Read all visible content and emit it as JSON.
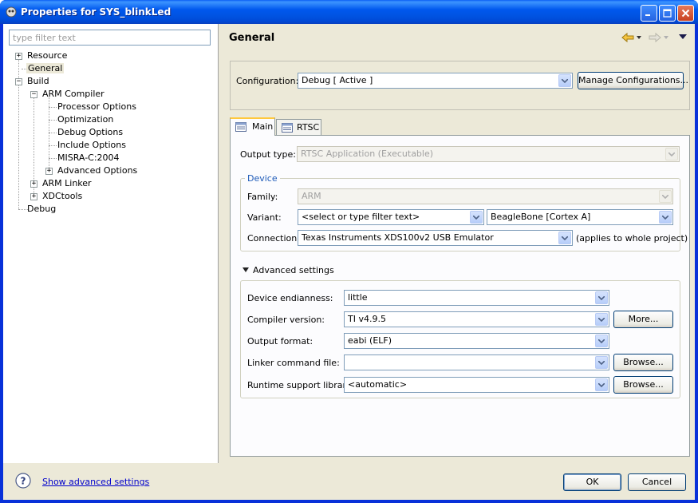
{
  "window": {
    "title": "Properties for SYS_blinkLed"
  },
  "filter": {
    "placeholder": "type filter text"
  },
  "tree": {
    "resource": "Resource",
    "general": "General",
    "build": "Build",
    "arm_compiler": "ARM Compiler",
    "processor_options": "Processor Options",
    "optimization": "Optimization",
    "debug_options": "Debug Options",
    "include_options": "Include Options",
    "misra": "MISRA-C:2004",
    "advanced_options": "Advanced Options",
    "arm_linker": "ARM Linker",
    "xdctools": "XDCtools",
    "debug": "Debug"
  },
  "page": {
    "title": "General"
  },
  "configuration": {
    "label": "Configuration:",
    "value": "Debug  [ Active ]",
    "manage_button": "Manage Configurations..."
  },
  "tabs": {
    "main": "Main",
    "rtsc": "RTSC"
  },
  "output_type": {
    "label": "Output type:",
    "value": "RTSC Application (Executable)"
  },
  "device": {
    "group_title": "Device",
    "family_label": "Family:",
    "family_value": "ARM",
    "variant_label": "Variant:",
    "variant_filter": "<select or type filter text>",
    "variant_value": "BeagleBone [Cortex A]",
    "connection_label": "Connection:",
    "connection_value": "Texas Instruments XDS100v2 USB Emulator",
    "connection_note": "(applies to whole project)"
  },
  "advanced": {
    "title": "Advanced settings",
    "endianness_label": "Device endianness:",
    "endianness_value": "little",
    "compiler_label": "Compiler version:",
    "compiler_value": "TI v4.9.5",
    "more_button": "More...",
    "format_label": "Output format:",
    "format_value": "eabi (ELF)",
    "linker_label": "Linker command file:",
    "linker_value": "",
    "linker_browse": "Browse...",
    "runtime_label": "Runtime support library:",
    "runtime_value": "<automatic>",
    "runtime_browse": "Browse..."
  },
  "footer": {
    "show_advanced": "Show advanced settings",
    "ok": "OK",
    "cancel": "Cancel"
  },
  "colors": {
    "titlebar": "#0058ee",
    "client": "#ece9d8",
    "link": "#0000cc",
    "active_tab": "#ffc83c"
  }
}
